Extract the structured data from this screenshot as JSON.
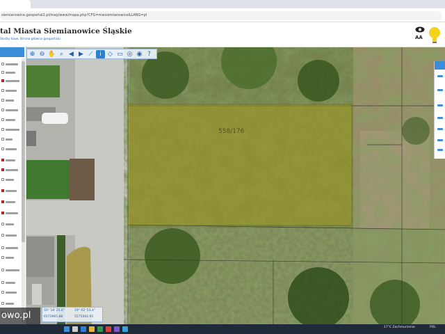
{
  "browser": {
    "url": "siemianowice.geoportal2.pl/map/www/mapa.php?CFG=mwsiemianowice&LANG=pl"
  },
  "site": {
    "title": "tal Miasta Siemianowice Śląskie",
    "subtitle": "Skróty klaw.  Strona główna geoportalu",
    "a11y_text_size_label": "AA"
  },
  "map": {
    "parcel_label": "558/176",
    "toolbar_buttons": [
      "zoom-in",
      "zoom-out",
      "pan",
      "zoom-box",
      "back",
      "forward",
      "measure-length",
      "info",
      "measure-area",
      "print",
      "search",
      "legend",
      "help"
    ],
    "active_tool_index": 7,
    "coords": {
      "line1_left": "50° 18' 25.6\"",
      "line1_right": "19° 02' 53.4\"",
      "line2_left": "6573965.88",
      "line2_right": "5575064.95"
    }
  },
  "watermark": {
    "text": "owo.pl"
  },
  "taskbar": {
    "weather": "17°C  Zachmurzenie",
    "lang": "POL"
  },
  "colors": {
    "accent": "#3c8ed8",
    "parcel_fill": "#a39b1f",
    "parcel_border": "#6e6a22",
    "taskbar": "#1f2a38"
  }
}
